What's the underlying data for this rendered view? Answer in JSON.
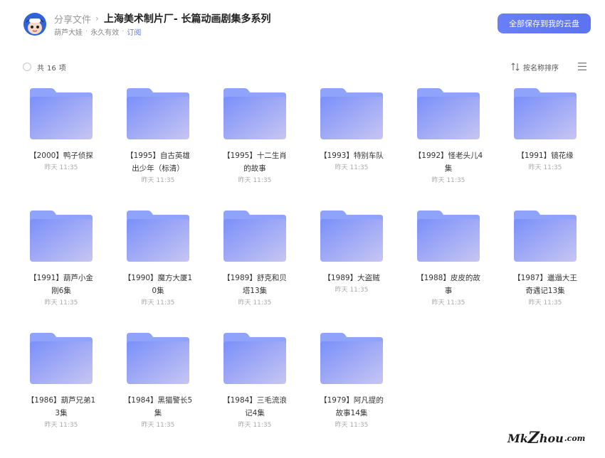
{
  "header": {
    "breadcrumb_root": "分享文件",
    "breadcrumb_sep": "›",
    "title": "上海美术制片厂- 长篇动画剧集多系列",
    "sharer": "葫芦大娃",
    "validity": "永久有效",
    "subscribe": "订阅",
    "dot": "·",
    "save_all": "全部保存到我的云盘"
  },
  "toolbar": {
    "count_prefix": "共",
    "count": "16",
    "count_suffix": "项",
    "sort_label": "按名称排序"
  },
  "folders": [
    {
      "name": "【2000】鸭子侦探",
      "time": "昨天 11:35"
    },
    {
      "name": "【1995】自古英雄出少年（标清）",
      "time": "昨天 11:35"
    },
    {
      "name": "【1995】十二生肖的故事",
      "time": "昨天 11:35"
    },
    {
      "name": "【1993】特别车队",
      "time": "昨天 11:35"
    },
    {
      "name": "【1992】怪老头儿4集",
      "time": "昨天 11:35"
    },
    {
      "name": "【1991】镜花缘",
      "time": "昨天 11:35"
    },
    {
      "name": "【1991】葫芦小金刚6集",
      "time": "昨天 11:35"
    },
    {
      "name": "【1990】魔方大厦10集",
      "time": "昨天 11:35"
    },
    {
      "name": "【1989】舒克和贝塔13集",
      "time": "昨天 11:35"
    },
    {
      "name": "【1989】大盗贼",
      "time": "昨天 11:35"
    },
    {
      "name": "【1988】皮皮的故事",
      "time": "昨天 11:35"
    },
    {
      "name": "【1987】邋遢大王奇遇记13集",
      "time": "昨天 11:35"
    },
    {
      "name": "【1986】葫芦兄弟13集",
      "time": "昨天 11:35"
    },
    {
      "name": "【1984】黑猫警长5集",
      "time": "昨天 11:35"
    },
    {
      "name": "【1984】三毛流浪记4集",
      "time": "昨天 11:35"
    },
    {
      "name": "【1979】阿凡提的故事14集",
      "time": "昨天 11:35"
    }
  ],
  "icons": {
    "avatar": "avatar-cartoon-icon",
    "select": "select-all-circle-icon",
    "sort": "sort-arrows-icon",
    "view": "list-view-icon",
    "folder": "folder-icon"
  },
  "colors": {
    "accent": "#5b73f2",
    "folder_back": "#8fa3fb",
    "folder_front_start": "#7a8ff9",
    "folder_front_end": "#c7c6f2"
  },
  "watermark": {
    "main": "Mk",
    "z": "Z",
    "rest": "hou",
    "tld": ".com"
  }
}
